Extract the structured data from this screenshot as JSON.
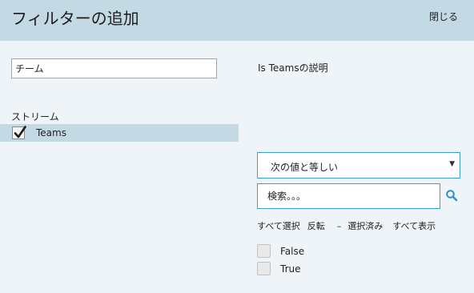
{
  "header": {
    "title": "フィルターの追加",
    "close_label": "閉じる"
  },
  "filter_name": {
    "value": "チーム"
  },
  "description": "Is Teamsの説明",
  "stream": {
    "label": "ストリーム",
    "item_name": "Teams",
    "checked": true
  },
  "condition": {
    "selected": "次の値と等しい"
  },
  "search": {
    "placeholder": "検索。。。",
    "value": ""
  },
  "actions": {
    "select_all": "すべて選択",
    "invert": "反転",
    "dash": "–",
    "selected": "選択済み",
    "show_all": "すべて表示"
  },
  "options": [
    {
      "label": "False",
      "checked": false
    },
    {
      "label": "True",
      "checked": false
    }
  ],
  "colors": {
    "header_bg": "#c3dae5",
    "page_bg": "#eef4f7",
    "accent": "#3aa0cf"
  },
  "icons": {
    "stream_check": "checkmark-icon",
    "search": "search-icon",
    "dropdown": "caret-down-icon"
  }
}
